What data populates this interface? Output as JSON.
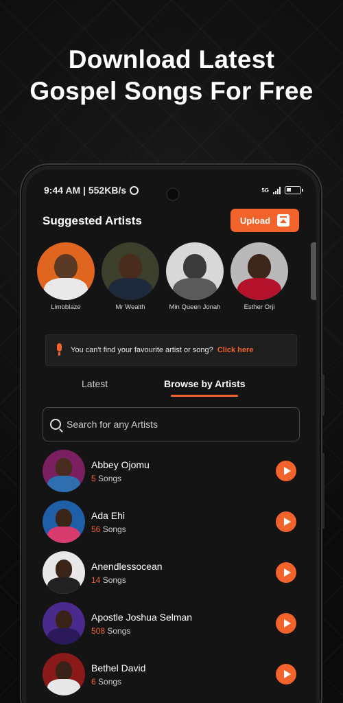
{
  "headline": {
    "line1": "Download Latest",
    "line2": "Gospel Songs For Free"
  },
  "status_bar": {
    "time": "9:44 AM | 552KB/s",
    "network": "5G"
  },
  "suggested": {
    "title": "Suggested Artists",
    "upload_label": "Upload",
    "artists": [
      {
        "name": "Limoblaze"
      },
      {
        "name": "Mr Wealth"
      },
      {
        "name": "Min Queen Jonah"
      },
      {
        "name": "Esther Orji"
      }
    ]
  },
  "notice": {
    "text": "You can't find your favourite artist or song?",
    "link": "Click here"
  },
  "tabs": {
    "latest": "Latest",
    "browse": "Browse by Artists"
  },
  "search": {
    "placeholder": "Search for any Artists"
  },
  "artist_list": [
    {
      "name": "Abbey Ojomu",
      "count": "5",
      "unit": " Songs"
    },
    {
      "name": "Ada Ehi",
      "count": "56",
      "unit": " Songs"
    },
    {
      "name": "Anendlessocean",
      "count": "14",
      "unit": " Songs"
    },
    {
      "name": "Apostle Joshua Selman",
      "count": "508",
      "unit": " Songs"
    },
    {
      "name": "Bethel David",
      "count": "6",
      "unit": " Songs"
    }
  ],
  "colors": {
    "accent": "#f2632b",
    "background": "#141414"
  }
}
